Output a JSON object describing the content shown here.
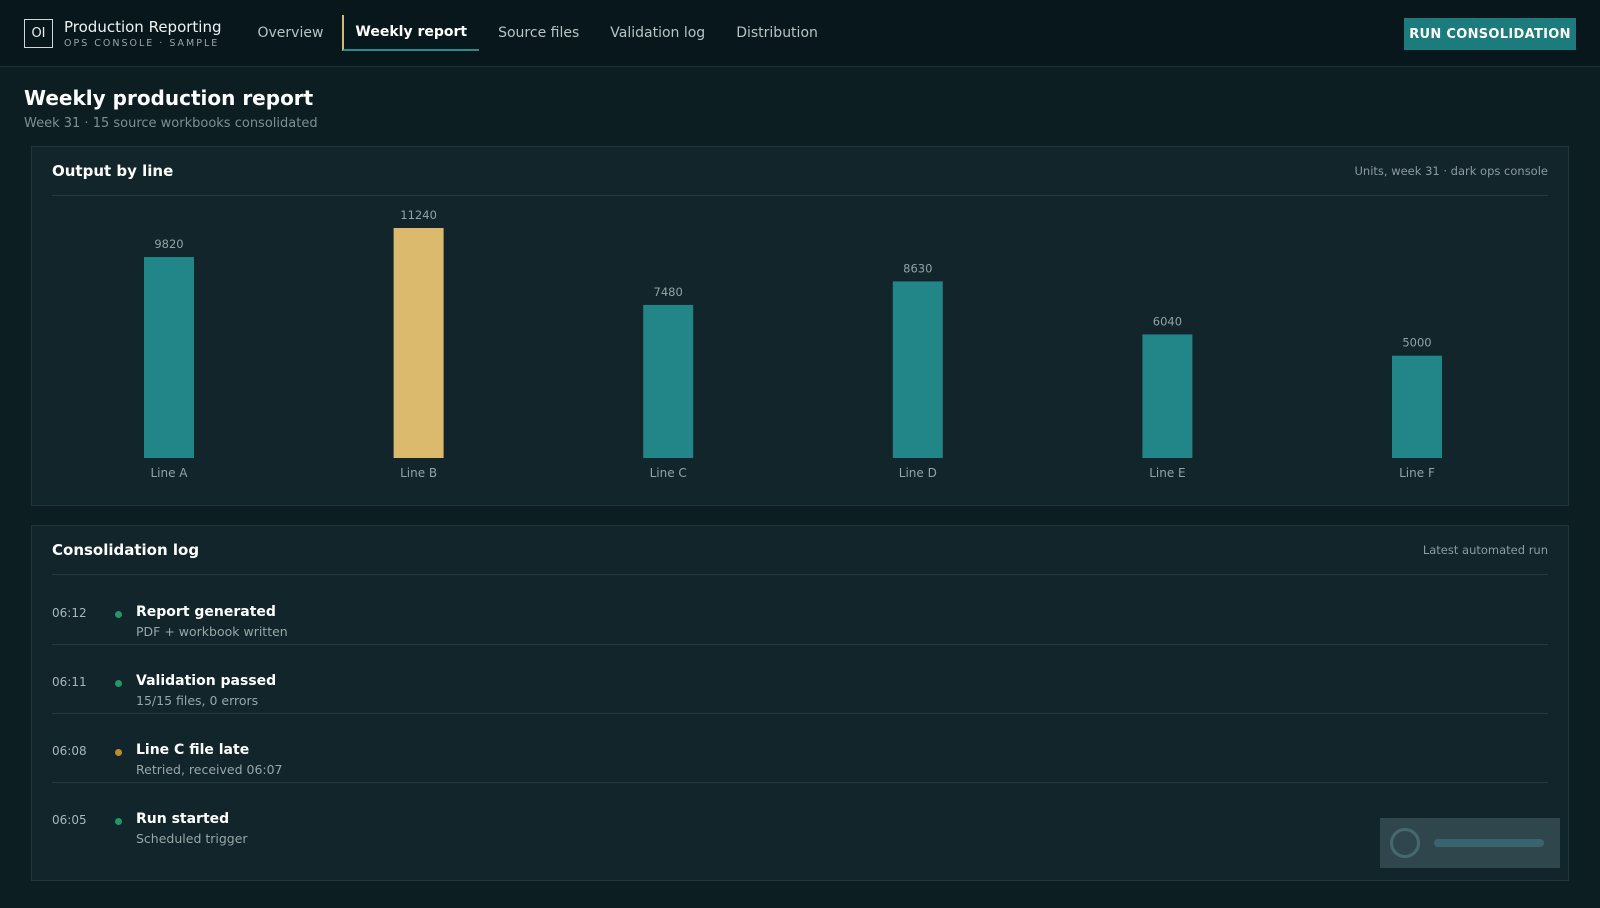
{
  "app": {
    "logo_text": "OI",
    "title": "Production Reporting",
    "subtitle": "OPS CONSOLE · SAMPLE"
  },
  "nav": {
    "items": [
      {
        "label": "Overview"
      },
      {
        "label": "Weekly report",
        "active": true
      },
      {
        "label": "Source files"
      },
      {
        "label": "Validation log"
      },
      {
        "label": "Distribution"
      }
    ]
  },
  "actions": {
    "run_label": "RUN CONSOLIDATION"
  },
  "page": {
    "title": "Weekly production report",
    "subtitle": "Week 31 · 15 source workbooks consolidated"
  },
  "chart_panel": {
    "title": "Output by line",
    "note": "Units, week 31 · dark ops console"
  },
  "chart_data": {
    "type": "bar",
    "categories": [
      "Line A",
      "Line B",
      "Line C",
      "Line D",
      "Line E",
      "Line F"
    ],
    "values": [
      9820,
      11240,
      7480,
      8630,
      6040,
      5000
    ],
    "highlight_index": 1,
    "colors": {
      "default": "#228689",
      "highlight": "#dbba6d"
    },
    "ylim": [
      0,
      11240
    ],
    "grid": false,
    "title": "",
    "xlabel": "",
    "ylabel": ""
  },
  "log_panel": {
    "title": "Consolidation log",
    "note": "Latest automated run",
    "entries": [
      {
        "time": "06:12",
        "title": "Report generated",
        "detail": "PDF + workbook written",
        "status": "ok"
      },
      {
        "time": "06:11",
        "title": "Validation passed",
        "detail": "15/15 files, 0 errors",
        "status": "ok"
      },
      {
        "time": "06:08",
        "title": "Line C file late",
        "detail": "Retried, received 06:07",
        "status": "warn"
      },
      {
        "time": "06:05",
        "title": "Run started",
        "detail": "Scheduled trigger",
        "status": "ok"
      }
    ]
  },
  "status_colors": {
    "ok": "#1f9a62",
    "warn": "#c08a2e"
  }
}
